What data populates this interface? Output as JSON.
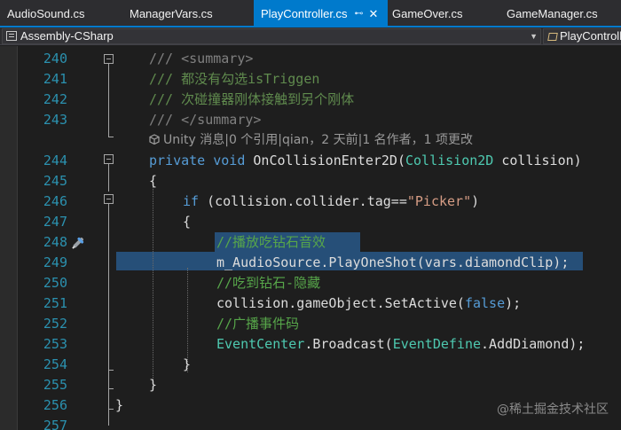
{
  "tabs": [
    {
      "label": "AudioSound.cs",
      "active": false
    },
    {
      "label": "ManagerVars.cs",
      "active": false
    },
    {
      "label": "PlayController.cs",
      "active": true
    },
    {
      "label": "GameOver.cs",
      "active": false
    },
    {
      "label": "GameManager.cs",
      "active": false
    }
  ],
  "tab_active_pin": "⊷",
  "tab_active_close": "✕",
  "navbar": {
    "project": "Assembly-CSharp",
    "class": "PlayControll"
  },
  "code": {
    "l240": {
      "ln": "240",
      "t": "/// <summary>"
    },
    "l241": {
      "ln": "241",
      "t": "/// 都没有勾选isTriggen"
    },
    "l242": {
      "ln": "242",
      "t": "/// 次碰撞器刚体接触到另个刚体"
    },
    "l243": {
      "ln": "243",
      "t": "/// </summary>"
    },
    "codelens": "Unity 消息|0 个引用|qian，2 天前|1 名作者，1 项更改",
    "l244": {
      "ln": "244",
      "kw1": "private",
      "kw2": "void",
      "name": "OnCollisionEnter2D",
      "open": "(",
      "type": "Collision2D",
      "param": " collision)"
    },
    "l245": {
      "ln": "245",
      "t": "{"
    },
    "l246": {
      "ln": "246",
      "kw": "if",
      "pre": " (collision.collider.tag==",
      "str": "\"Picker\"",
      "post": ")"
    },
    "l247": {
      "ln": "247",
      "t": "{"
    },
    "l248": {
      "ln": "248",
      "t": "//播放吃钻石音效"
    },
    "l249": {
      "ln": "249",
      "t": "m_AudioSource.PlayOneShot(vars.diamondClip);"
    },
    "l250": {
      "ln": "250",
      "t": "//吃到钻石-隐藏"
    },
    "l251": {
      "ln": "251",
      "pre": "collision.gameObject.SetActive(",
      "kw": "false",
      "post": ");"
    },
    "l252": {
      "ln": "252",
      "t": "//广播事件码"
    },
    "l253": {
      "ln": "253",
      "type1": "EventCenter",
      "mid": ".Broadcast(",
      "type2": "EventDefine",
      "post": ".AddDiamond);"
    },
    "l254": {
      "ln": "254",
      "t": "}"
    },
    "l255": {
      "ln": "255",
      "t": "}"
    },
    "l256": {
      "ln": "256",
      "t": "}"
    },
    "l257": {
      "ln": "257"
    }
  },
  "watermark": "@稀土掘金技术社区",
  "colors": {
    "accent": "#007acc",
    "selection": "#264f78",
    "line_number": "#2b91af",
    "keyword": "#569cd6",
    "type": "#4ec9b0",
    "comment": "#57a64a",
    "string": "#d69d85"
  }
}
